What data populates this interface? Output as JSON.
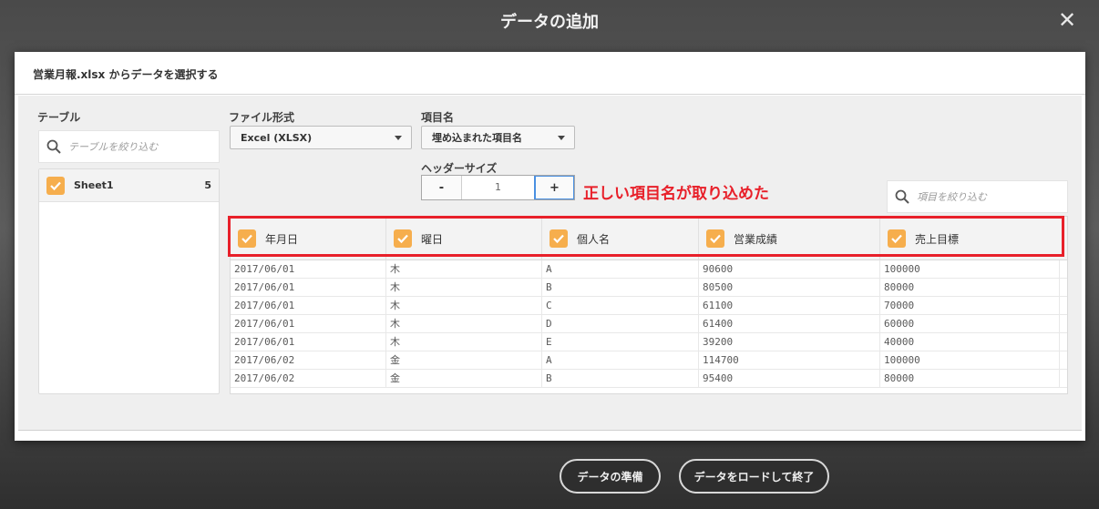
{
  "window": {
    "title": "データの追加",
    "close_label": "✕"
  },
  "dialog": {
    "header": "営業月報.xlsx からデータを選択する",
    "tables_panel": {
      "label": "テーブル",
      "search_placeholder": "テーブルを絞り込む",
      "items": [
        {
          "name": "Sheet1",
          "count": "5",
          "checked": true
        }
      ]
    },
    "file_format": {
      "label": "ファイル形式",
      "value": "Excel (XLSX)"
    },
    "field_names": {
      "label": "項目名",
      "value": "埋め込まれた項目名"
    },
    "header_size": {
      "label": "ヘッダーサイズ",
      "value": "1",
      "minus": "-",
      "plus": "+"
    },
    "annotation": "正しい項目名が取り込めた",
    "field_search_placeholder": "項目を絞り込む",
    "columns": [
      "年月日",
      "曜日",
      "個人名",
      "営業成績",
      "売上目標"
    ],
    "rows": [
      [
        "2017/06/01",
        "木",
        "A",
        "90600",
        "100000"
      ],
      [
        "2017/06/01",
        "木",
        "B",
        "80500",
        "80000"
      ],
      [
        "2017/06/01",
        "木",
        "C",
        "61100",
        "70000"
      ],
      [
        "2017/06/01",
        "木",
        "D",
        "61400",
        "60000"
      ],
      [
        "2017/06/01",
        "木",
        "E",
        "39200",
        "40000"
      ],
      [
        "2017/06/02",
        "金",
        "A",
        "114700",
        "100000"
      ],
      [
        "2017/06/02",
        "金",
        "B",
        "95400",
        "80000"
      ]
    ]
  },
  "footer": {
    "prepare_label": "データの準備",
    "load_label": "データをロードして終了"
  },
  "colors": {
    "accent_checkbox": "#f6ae4d",
    "annotation_red": "#e8202a"
  }
}
